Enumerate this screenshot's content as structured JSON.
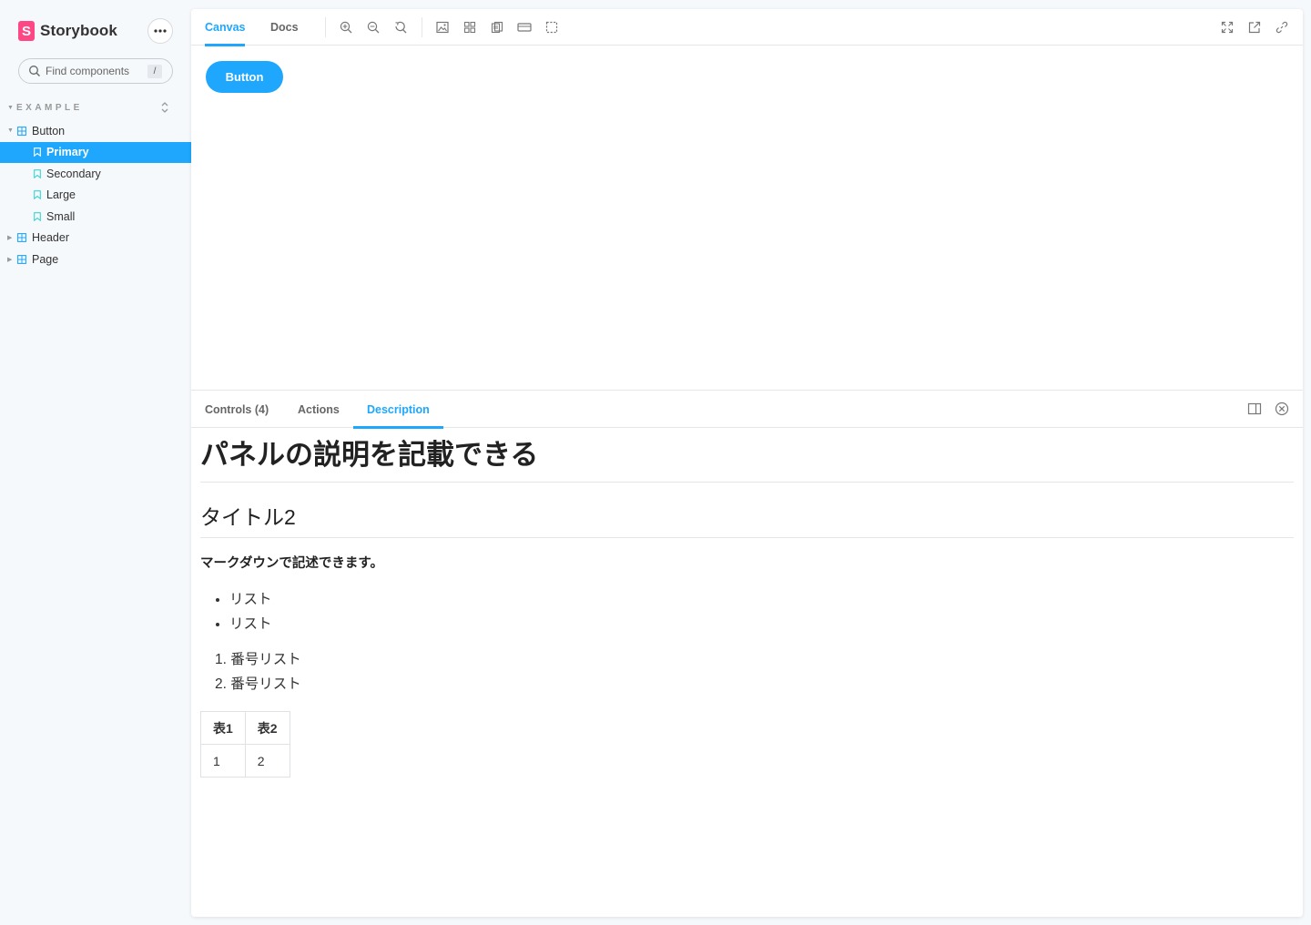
{
  "app": {
    "brand_name": "Storybook",
    "logo_letter": "S",
    "brand_color": "#FF4785",
    "accent_color": "#1EA7FD"
  },
  "sidebar": {
    "search": {
      "placeholder": "Find components",
      "shortcut": "/"
    },
    "section_label": "EXAMPLE",
    "tree": [
      {
        "kind": "component",
        "label": "Button",
        "expanded": true
      },
      {
        "kind": "story",
        "label": "Primary",
        "selected": true
      },
      {
        "kind": "story",
        "label": "Secondary",
        "selected": false
      },
      {
        "kind": "story",
        "label": "Large",
        "selected": false
      },
      {
        "kind": "story",
        "label": "Small",
        "selected": false
      },
      {
        "kind": "component",
        "label": "Header",
        "expanded": false
      },
      {
        "kind": "component",
        "label": "Page",
        "expanded": false
      }
    ]
  },
  "toolbar": {
    "tabs": {
      "canvas": "Canvas",
      "docs": "Docs"
    },
    "tools": [
      "zoom-in-icon",
      "zoom-out-icon",
      "zoom-reset-icon",
      "background-icon",
      "grid-icon",
      "viewport-icon",
      "measure-icon",
      "outline-icon"
    ],
    "right_tools": [
      "fullscreen-icon",
      "open-new-tab-icon",
      "copy-link-icon"
    ]
  },
  "canvas": {
    "preview_button_label": "Button"
  },
  "addons": {
    "tabs": {
      "controls": "Controls (4)",
      "actions": "Actions",
      "description": "Description"
    },
    "active_tab": "description"
  },
  "description": {
    "h1": "パネルの説明を記載できる",
    "h2": "タイトル2",
    "paragraph": "マークダウンで記述できます。",
    "bullets": [
      "リスト",
      "リスト"
    ],
    "numbered": [
      "番号リスト",
      "番号リスト"
    ],
    "table": {
      "headers": [
        "表1",
        "表2"
      ],
      "rows": [
        [
          "1",
          "2"
        ]
      ]
    }
  }
}
